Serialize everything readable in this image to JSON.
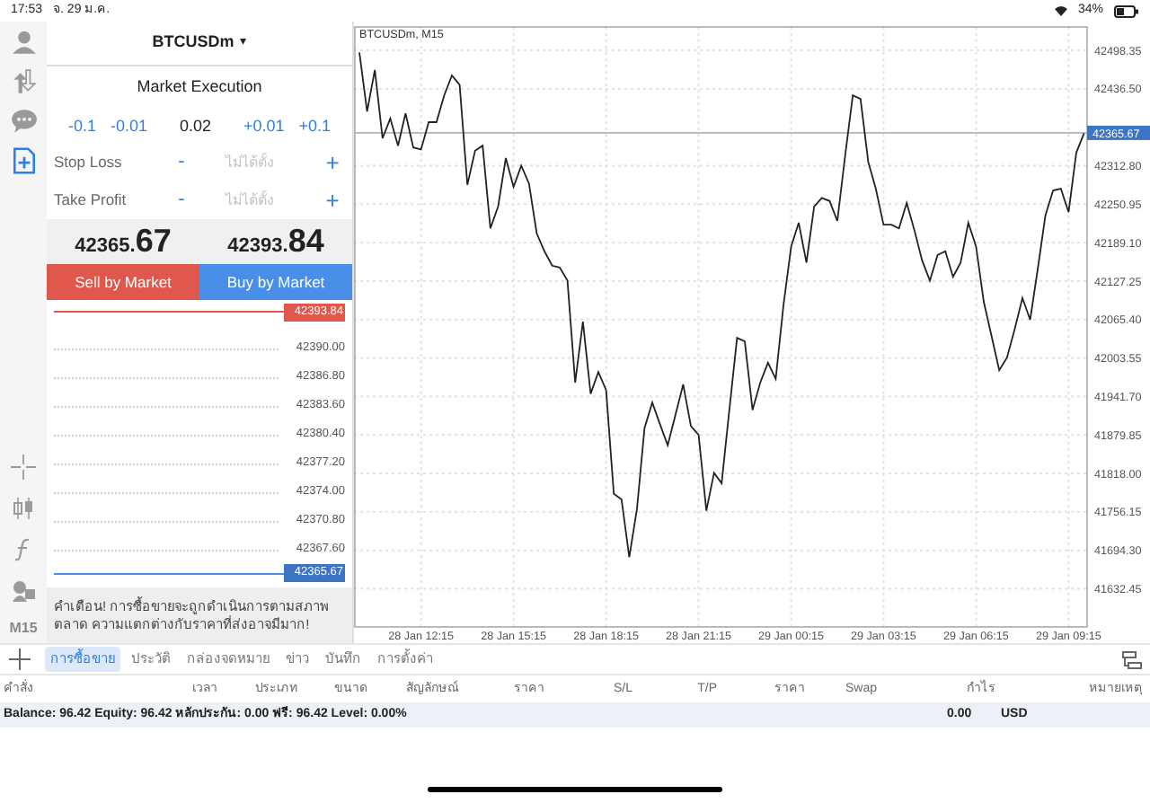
{
  "status_bar": {
    "time": "17:53",
    "date": "จ. 29 ม.ค.",
    "battery": "34%"
  },
  "toolbar": {
    "top": [
      {
        "kind": "account",
        "selected": false
      },
      {
        "kind": "transfer",
        "selected": false
      },
      {
        "kind": "chat",
        "selected": false
      },
      {
        "kind": "new_order",
        "selected": true
      }
    ],
    "bottom": [
      {
        "kind": "crosshair"
      },
      {
        "kind": "indicators"
      },
      {
        "kind": "function"
      },
      {
        "kind": "objects"
      }
    ],
    "timeframe": "M15"
  },
  "order_panel": {
    "symbol": "BTCUSDm",
    "dropdown": "▾",
    "execution": "Market Execution",
    "volume": {
      "steps_down": [
        "-0.1",
        "-0.01"
      ],
      "value": "0.02",
      "steps_up": [
        "+0.01",
        "+0.1"
      ]
    },
    "levels": [
      {
        "label": "Stop Loss",
        "minus": "-",
        "placeholder": "ไม่ได้ตั้ง",
        "plus": "+"
      },
      {
        "label": "Take Profit",
        "minus": "-",
        "placeholder": "ไม่ได้ตั้ง",
        "plus": "+"
      }
    ],
    "bid": "42365.**67**",
    "ask": "42393.**84**",
    "buttons": [
      {
        "kind": "sell",
        "label": "Sell by Market"
      },
      {
        "kind": "buy",
        "label": "Buy by Market"
      }
    ],
    "depth": [
      {
        "kind": "ask",
        "price": "42393.84"
      },
      {
        "kind": "tick",
        "price": "42390.00"
      },
      {
        "kind": "tick",
        "price": "42386.80"
      },
      {
        "kind": "tick",
        "price": "42383.60"
      },
      {
        "kind": "tick",
        "price": "42380.40"
      },
      {
        "kind": "tick",
        "price": "42377.20"
      },
      {
        "kind": "tick",
        "price": "42374.00"
      },
      {
        "kind": "tick",
        "price": "42370.80"
      },
      {
        "kind": "tick",
        "price": "42367.60"
      },
      {
        "kind": "bid",
        "price": "42365.67"
      }
    ],
    "warning": "คำเตือน! การซื้อขายจะถูกดำเนินการตามสภาพตลาด ความแตกต่างกับราคาที่ส่งอาจมีมาก!"
  },
  "chart": {
    "chart_data": {
      "type": "line",
      "title": "BTCUSDm, M15",
      "categories": [
        null,
        null,
        null,
        null,
        null,
        null,
        null,
        null,
        "28 Jan 12:15",
        null,
        null,
        null,
        null,
        null,
        null,
        null,
        null,
        null,
        null,
        null,
        "28 Jan 15:15",
        null,
        null,
        null,
        null,
        null,
        null,
        null,
        null,
        null,
        null,
        null,
        "28 Jan 18:15",
        null,
        null,
        null,
        null,
        null,
        null,
        null,
        null,
        null,
        null,
        null,
        "28 Jan 21:15",
        null,
        null,
        null,
        null,
        null,
        null,
        null,
        null,
        null,
        null,
        null,
        "29 Jan 00:15",
        null,
        null,
        null,
        null,
        null,
        null,
        null,
        null,
        null,
        null,
        null,
        "29 Jan 03:15",
        null,
        null,
        null,
        null,
        null,
        null,
        null,
        null,
        null,
        null,
        null,
        "29 Jan 06:15",
        null,
        null,
        null,
        null,
        null,
        null,
        null,
        null,
        null,
        null,
        null,
        "29 Jan 09:15",
        null,
        null
      ],
      "series": [
        {
          "color": "#222222",
          "values": [
            42495,
            42400,
            42467,
            42357,
            42389,
            42345,
            42397,
            42342,
            42339,
            42383,
            42383,
            42426,
            42458,
            42443,
            42282,
            42337,
            42345,
            42212,
            42247,
            42325,
            42279,
            42313,
            42284,
            42204,
            42175,
            42152,
            42149,
            42128,
            41964,
            42062,
            41946,
            41981,
            41952,
            41785,
            41776,
            41683,
            41761,
            41891,
            41932,
            41897,
            41863,
            41912,
            41961,
            41894,
            41880,
            41758,
            41819,
            41802,
            41920,
            42036,
            42030,
            41920,
            41964,
            41996,
            41970,
            42088,
            42183,
            42221,
            42157,
            42247,
            42261,
            42256,
            42224,
            42328,
            42426,
            42420,
            42319,
            42276,
            42218,
            42218,
            42212,
            42253,
            42209,
            42160,
            42128,
            42169,
            42175,
            42134,
            42157,
            42221,
            42183,
            42094,
            42039,
            41984,
            42004,
            42050,
            42100,
            42065,
            42146,
            42233,
            42273,
            42276,
            42238,
            42334,
            42365
          ]
        }
      ],
      "ylim": [
        41571,
        42536
      ],
      "yticks": [
        {
          "value": 42498.35,
          "label": "42498.35"
        },
        {
          "value": 42436.5,
          "label": "42436.50"
        },
        {
          "value": 42312.8,
          "label": "42312.80"
        },
        {
          "value": 42250.95,
          "label": "42250.95"
        },
        {
          "value": 42189.1,
          "label": "42189.10"
        },
        {
          "value": 42127.25,
          "label": "42127.25"
        },
        {
          "value": 42065.4,
          "label": "42065.40"
        },
        {
          "value": 42003.55,
          "label": "42003.55"
        },
        {
          "value": 41941.7,
          "label": "41941.70"
        },
        {
          "value": 41879.85,
          "label": "41879.85"
        },
        {
          "value": 41818,
          "label": "41818.00"
        },
        {
          "value": 41756.15,
          "label": "41756.15"
        },
        {
          "value": 41694.3,
          "label": "41694.30"
        },
        {
          "value": 41632.45,
          "label": "41632.45"
        }
      ],
      "grid": true,
      "ref_lines": [
        {
          "axis": "y",
          "value": 42365.67,
          "label": "42365.67"
        }
      ]
    }
  },
  "bottom_tabs": [
    {
      "label": "การซื้อขาย",
      "selected": true
    },
    {
      "label": "ประวัติ",
      "selected": false
    },
    {
      "label": "กล่องจดหมาย",
      "selected": false
    },
    {
      "label": "ข่าว",
      "selected": false
    },
    {
      "label": "บันทึก",
      "selected": false
    },
    {
      "label": "การตั้งค่า",
      "selected": false
    }
  ],
  "table": {
    "columns": [
      "คำสั่ง",
      "เวลา",
      "ประเภท",
      "ขนาด",
      "สัญลักษณ์",
      "ราคา",
      "S/L",
      "T/P",
      "ราคา",
      "Swap",
      "กำไร",
      "หมายเหตุ"
    ],
    "summary": {
      "text": "Balance: 96.42 Equity: 96.42 หลักประกัน: 0.00 ฟรี: 96.42 Level: 0.00%",
      "profit": "0.00",
      "currency": "USD"
    }
  }
}
